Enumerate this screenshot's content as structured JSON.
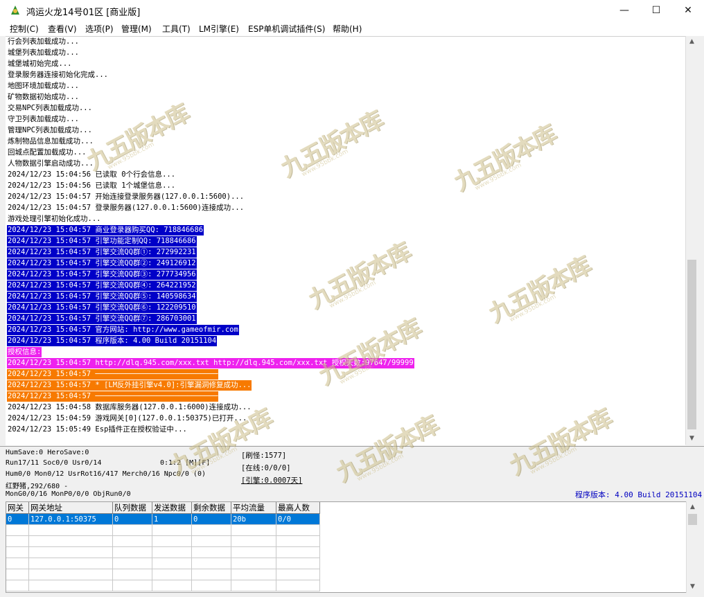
{
  "window": {
    "title": "鸿运火龙14号01区 [商业版]",
    "minimize_glyph": "—",
    "maximize_glyph": "☐",
    "close_glyph": "✕"
  },
  "menu": [
    "控制(C)",
    "查看(V)",
    "选项(P)",
    "管理(M)",
    "工具(T)",
    "LM引擎(E)",
    "ESP单机调试插件(S)",
    "帮助(H)"
  ],
  "log": [
    {
      "text": "行会列表加载成功...",
      "hl": ""
    },
    {
      "text": "城堡列表加载成功...",
      "hl": ""
    },
    {
      "text": "城堡城初始完成...",
      "hl": ""
    },
    {
      "text": "登录服务器连接初始化完成...",
      "hl": ""
    },
    {
      "text": "地图环境加载成功...",
      "hl": ""
    },
    {
      "text": "矿物数据初始成功...",
      "hl": ""
    },
    {
      "text": "交易NPC列表加载成功...",
      "hl": ""
    },
    {
      "text": "守卫列表加载成功...",
      "hl": ""
    },
    {
      "text": "管理NPC列表加载成功...",
      "hl": ""
    },
    {
      "text": "炼制物品信息加载成功...",
      "hl": ""
    },
    {
      "text": "回城点配置加载成功...",
      "hl": ""
    },
    {
      "text": "人物数据引擎启动成功...",
      "hl": ""
    },
    {
      "text": "2024/12/23 15:04:56 已读取 0个行会信息...",
      "hl": ""
    },
    {
      "text": "2024/12/23 15:04:56 已读取 1个城堡信息...",
      "hl": ""
    },
    {
      "text": "2024/12/23 15:04:57 开始连接登录服务器(127.0.0.1:5600)...",
      "hl": ""
    },
    {
      "text": "2024/12/23 15:04:57 登录服务器(127.0.0.1:5600)连接成功...",
      "hl": ""
    },
    {
      "text": "游戏处理引擎初始化成功...",
      "hl": ""
    },
    {
      "text": "2024/12/23 15:04:57 商业登录器购买QQ: 718846686",
      "hl": "blue"
    },
    {
      "text": "2024/12/23 15:04:57 引擎功能定制QQ: 718846686",
      "hl": "blue"
    },
    {
      "text": "2024/12/23 15:04:57 引擎交流QQ群①: 272992231",
      "hl": "blue"
    },
    {
      "text": "2024/12/23 15:04:57 引擎交流QQ群②: 249126912",
      "hl": "blue"
    },
    {
      "text": "2024/12/23 15:04:57 引擎交流QQ群③: 277734956",
      "hl": "blue"
    },
    {
      "text": "2024/12/23 15:04:57 引擎交流QQ群④: 264221952",
      "hl": "blue"
    },
    {
      "text": "2024/12/23 15:04:57 引擎交流QQ群⑤: 140598634",
      "hl": "blue"
    },
    {
      "text": "2024/12/23 15:04:57 引擎交流QQ群⑥: 122209510",
      "hl": "blue"
    },
    {
      "text": "2024/12/23 15:04:57 引擎交流QQ群⑦: 286703001",
      "hl": "blue"
    },
    {
      "text": "2024/12/23 15:04:57 官方网站: http://www.gameofmir.com",
      "hl": "blue"
    },
    {
      "text": "2024/12/23 15:04:57 程序版本: 4.00 Build 20151104",
      "hl": "blue"
    },
    {
      "text": "授权信息:",
      "hl": "mag"
    },
    {
      "text": "2024/12/23 15:04:57 http://dlq.945.com/xxx.txt http://dlq.945.com/xxx.txt 授权天数:97647/99999",
      "hl": "mag"
    },
    {
      "text": "2024/12/23 15:04:57 ────────────────────────────",
      "hl": "orange"
    },
    {
      "text": "2024/12/23 15:04:57 * [LM反外挂引擎v4.0]:引擎漏洞修复成功...",
      "hl": "orange"
    },
    {
      "text": "2024/12/23 15:04:57 ────────────────────────────",
      "hl": "orange"
    },
    {
      "text": "2024/12/23 15:04:58 数据库服务器(127.0.0.1:6000)连接成功...",
      "hl": ""
    },
    {
      "text": "2024/12/23 15:04:59 游戏网关[0](127.0.0.1:50375)已打开...",
      "hl": ""
    },
    {
      "text": "2024/12/23 15:05:49 Esp插件正在授权验证中...",
      "hl": ""
    }
  ],
  "status": {
    "line1": "HumSave:0 HeroSave:0",
    "line2": "Run17/11 Soc0/0 Usr0/14",
    "line2b": "0:1:2 [M][F]",
    "line3": "Hum0/0 Mon0/12 UsrRot16/417 Merch0/16 Npc0/0 (0)",
    "line4": "红野猪,292/680 -",
    "line5": "MonG0/0/16 MonP0/0/0 ObjRun0/0",
    "box1": "[刷怪:1577]",
    "box2": "[在线:0/0/0]",
    "box3": "[引擎:0.0007天]",
    "version": "程序版本: 4.00 Build 20151104"
  },
  "grid": {
    "headers": [
      "网关",
      "网关地址",
      "队列数据",
      "发送数据",
      "剩余数据",
      "平均流量",
      "最高人数"
    ],
    "rows": [
      [
        "0",
        "127.0.0.1:50375",
        "0",
        "1",
        "0",
        "20b",
        "0/0"
      ]
    ],
    "empty_rows": 6
  },
  "watermark": {
    "text": "九五版本库",
    "sub": "www.95bbk.com"
  },
  "colors": {
    "highlight_blue": "#0000c8",
    "highlight_magenta": "#ee22ee",
    "highlight_orange": "#f77a00",
    "version_text": "#0000c0",
    "grid_selection": "#0078d7"
  }
}
